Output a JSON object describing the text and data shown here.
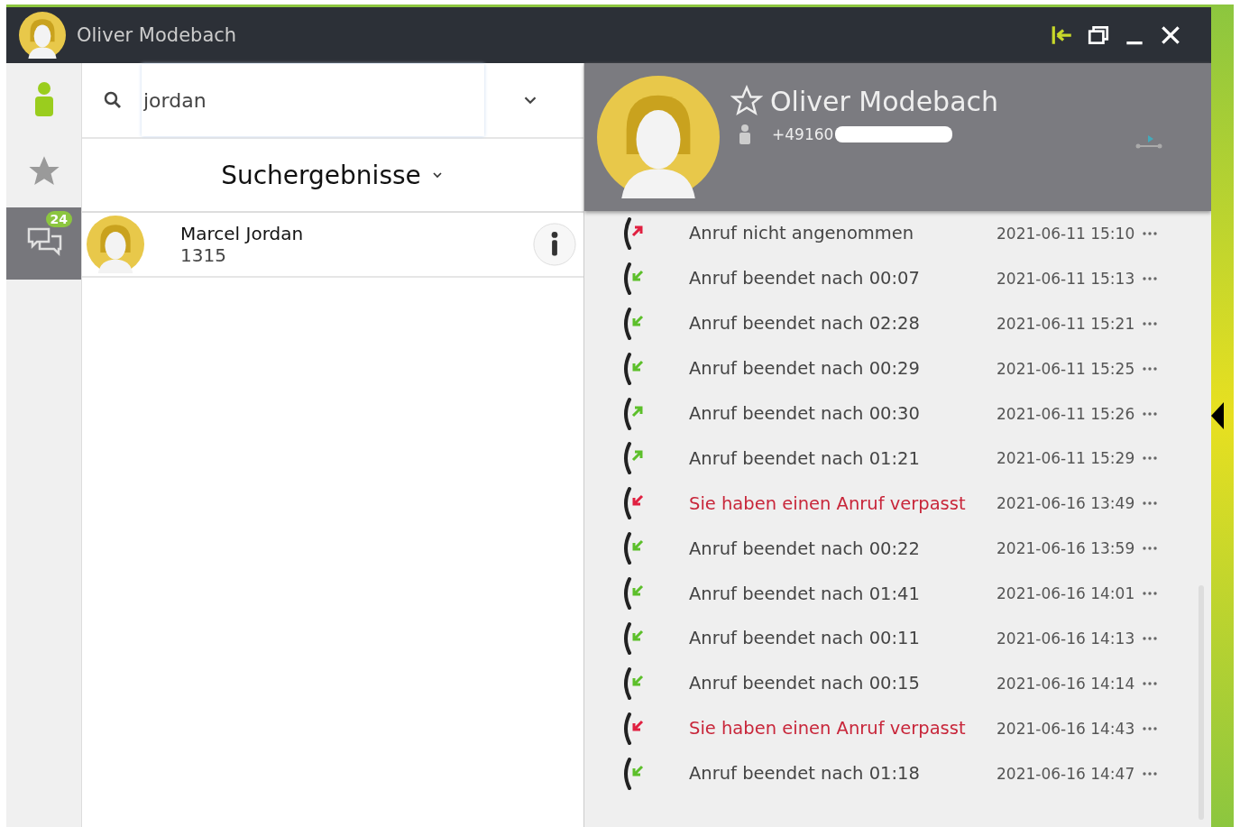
{
  "window": {
    "title": "Oliver Modebach"
  },
  "rail": [
    {
      "kind": "contacts",
      "selected": false
    },
    {
      "kind": "favorites",
      "selected": false
    },
    {
      "kind": "chats",
      "selected": true,
      "badge": "24"
    }
  ],
  "search": {
    "value": "jordan"
  },
  "results": {
    "title": "Suchergebnisse",
    "items": [
      {
        "name": "Marcel Jordan",
        "number": "1315"
      }
    ]
  },
  "contact": {
    "name": "Oliver Modebach",
    "phone": "+49160",
    "favorite": false
  },
  "calls": [
    {
      "kind": "outgoing-unanswered",
      "text": "Anruf nicht angenommen",
      "time": "2021-06-11 15:10"
    },
    {
      "kind": "incoming",
      "text": "Anruf beendet nach 00:07",
      "time": "2021-06-11 15:13"
    },
    {
      "kind": "incoming",
      "text": "Anruf beendet nach 02:28",
      "time": "2021-06-11 15:21"
    },
    {
      "kind": "incoming",
      "text": "Anruf beendet nach 00:29",
      "time": "2021-06-11 15:25"
    },
    {
      "kind": "outgoing",
      "text": "Anruf beendet nach 00:30",
      "time": "2021-06-11 15:26"
    },
    {
      "kind": "outgoing",
      "text": "Anruf beendet nach 01:21",
      "time": "2021-06-11 15:29"
    },
    {
      "kind": "missed",
      "text": "Sie haben einen Anruf verpasst",
      "time": "2021-06-16 13:49"
    },
    {
      "kind": "incoming",
      "text": "Anruf beendet nach 00:22",
      "time": "2021-06-16 13:59"
    },
    {
      "kind": "incoming",
      "text": "Anruf beendet nach 01:41",
      "time": "2021-06-16 14:01"
    },
    {
      "kind": "incoming",
      "text": "Anruf beendet nach 00:11",
      "time": "2021-06-16 14:13"
    },
    {
      "kind": "incoming",
      "text": "Anruf beendet nach 00:15",
      "time": "2021-06-16 14:14"
    },
    {
      "kind": "missed",
      "text": "Sie haben einen Anruf verpasst",
      "time": "2021-06-16 14:43"
    },
    {
      "kind": "incoming",
      "text": "Anruf beendet nach 01:18",
      "time": "2021-06-16 14:47"
    }
  ]
}
